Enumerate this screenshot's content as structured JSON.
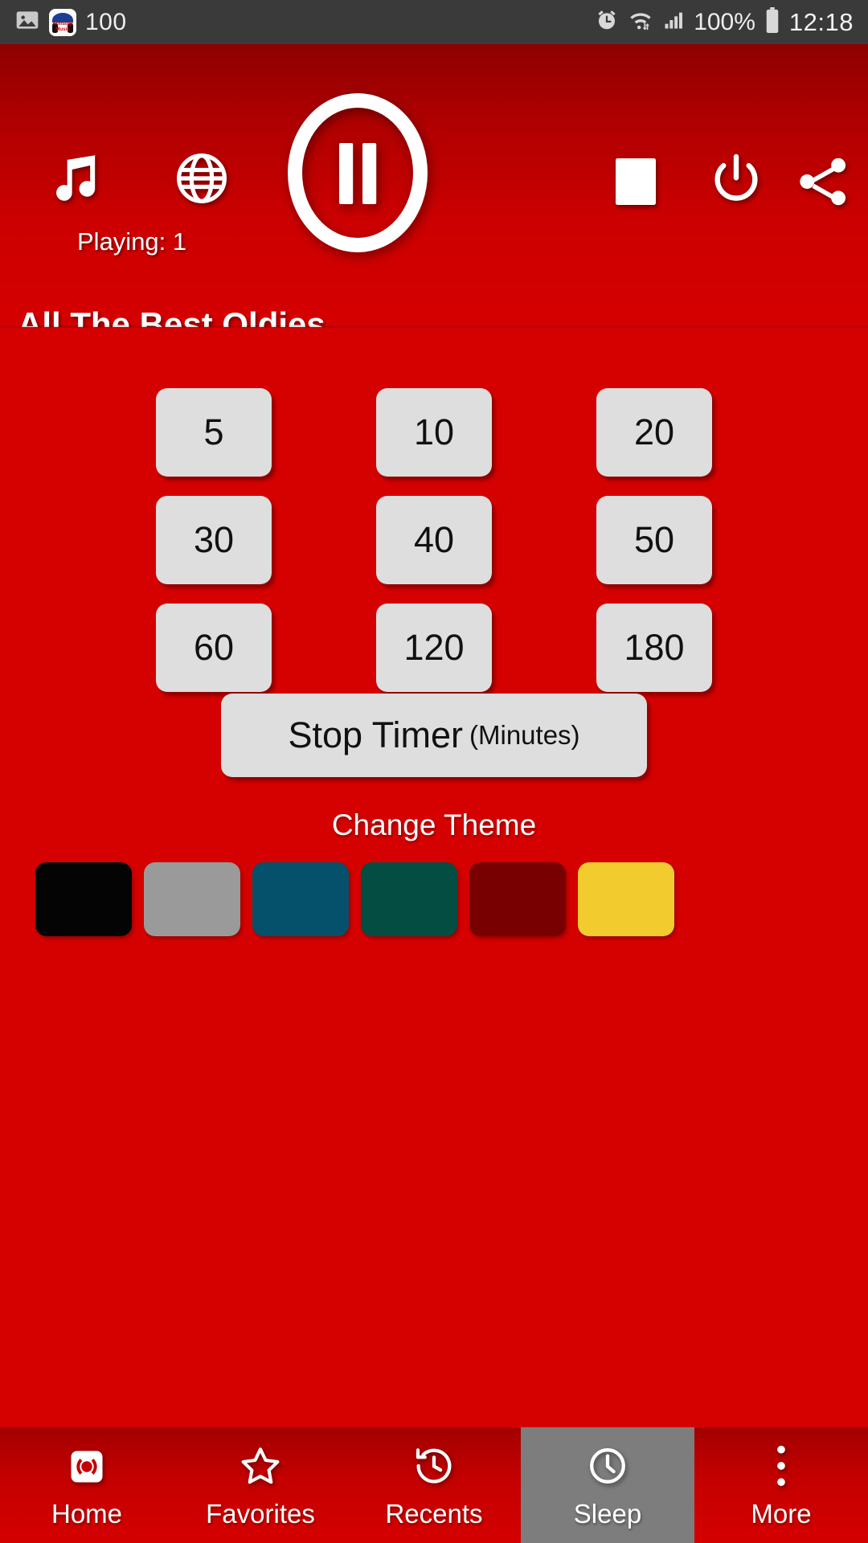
{
  "status_bar": {
    "left_icons": [
      "image-icon",
      "nonstop-music-app-icon"
    ],
    "app_badge_line1": "Nonstop",
    "app_badge_line2": "Music",
    "notification_count": "100",
    "right_icons": [
      "alarm-icon",
      "wifi-icon",
      "signal-icon",
      "battery-icon"
    ],
    "battery_percent": "100%",
    "time": "12:18"
  },
  "player": {
    "music_icon": "music-note-icon",
    "globe_icon": "globe-icon",
    "play_pause_icon": "pause-icon",
    "stop_icon": "stop-square-icon",
    "power_icon": "power-icon",
    "share_icon": "share-icon",
    "playing_label": "Playing: 1",
    "station_title": "All The Best Oldies"
  },
  "sleep_timer": {
    "rows": [
      [
        "5",
        "10",
        "20"
      ],
      [
        "30",
        "40",
        "50"
      ],
      [
        "60",
        "120",
        "180"
      ]
    ],
    "stop_button_main": "Stop Timer",
    "stop_button_sub": "(Minutes)"
  },
  "theme": {
    "label": "Change Theme",
    "swatches": [
      {
        "name": "black",
        "color": "#040404"
      },
      {
        "name": "gray",
        "color": "#9a9a9a"
      },
      {
        "name": "blue",
        "color": "#05506b"
      },
      {
        "name": "green",
        "color": "#034d42"
      },
      {
        "name": "maroon",
        "color": "#780000"
      },
      {
        "name": "yellow",
        "color": "#f2cb2e"
      }
    ]
  },
  "bottom_nav": {
    "items": [
      {
        "label": "Home",
        "icon": "radio-broadcast-icon",
        "active": false
      },
      {
        "label": "Favorites",
        "icon": "star-icon",
        "active": false
      },
      {
        "label": "Recents",
        "icon": "history-clock-icon",
        "active": false
      },
      {
        "label": "Sleep",
        "icon": "clock-icon",
        "active": true
      },
      {
        "label": "More",
        "icon": "overflow-dots-icon",
        "active": false
      }
    ]
  },
  "colors": {
    "background_red": "#d50000",
    "header_dark_red": "#8e0000",
    "button_gray": "#dededf",
    "active_nav_gray": "#7d7d7d",
    "status_bar": "#3a3a3a"
  }
}
